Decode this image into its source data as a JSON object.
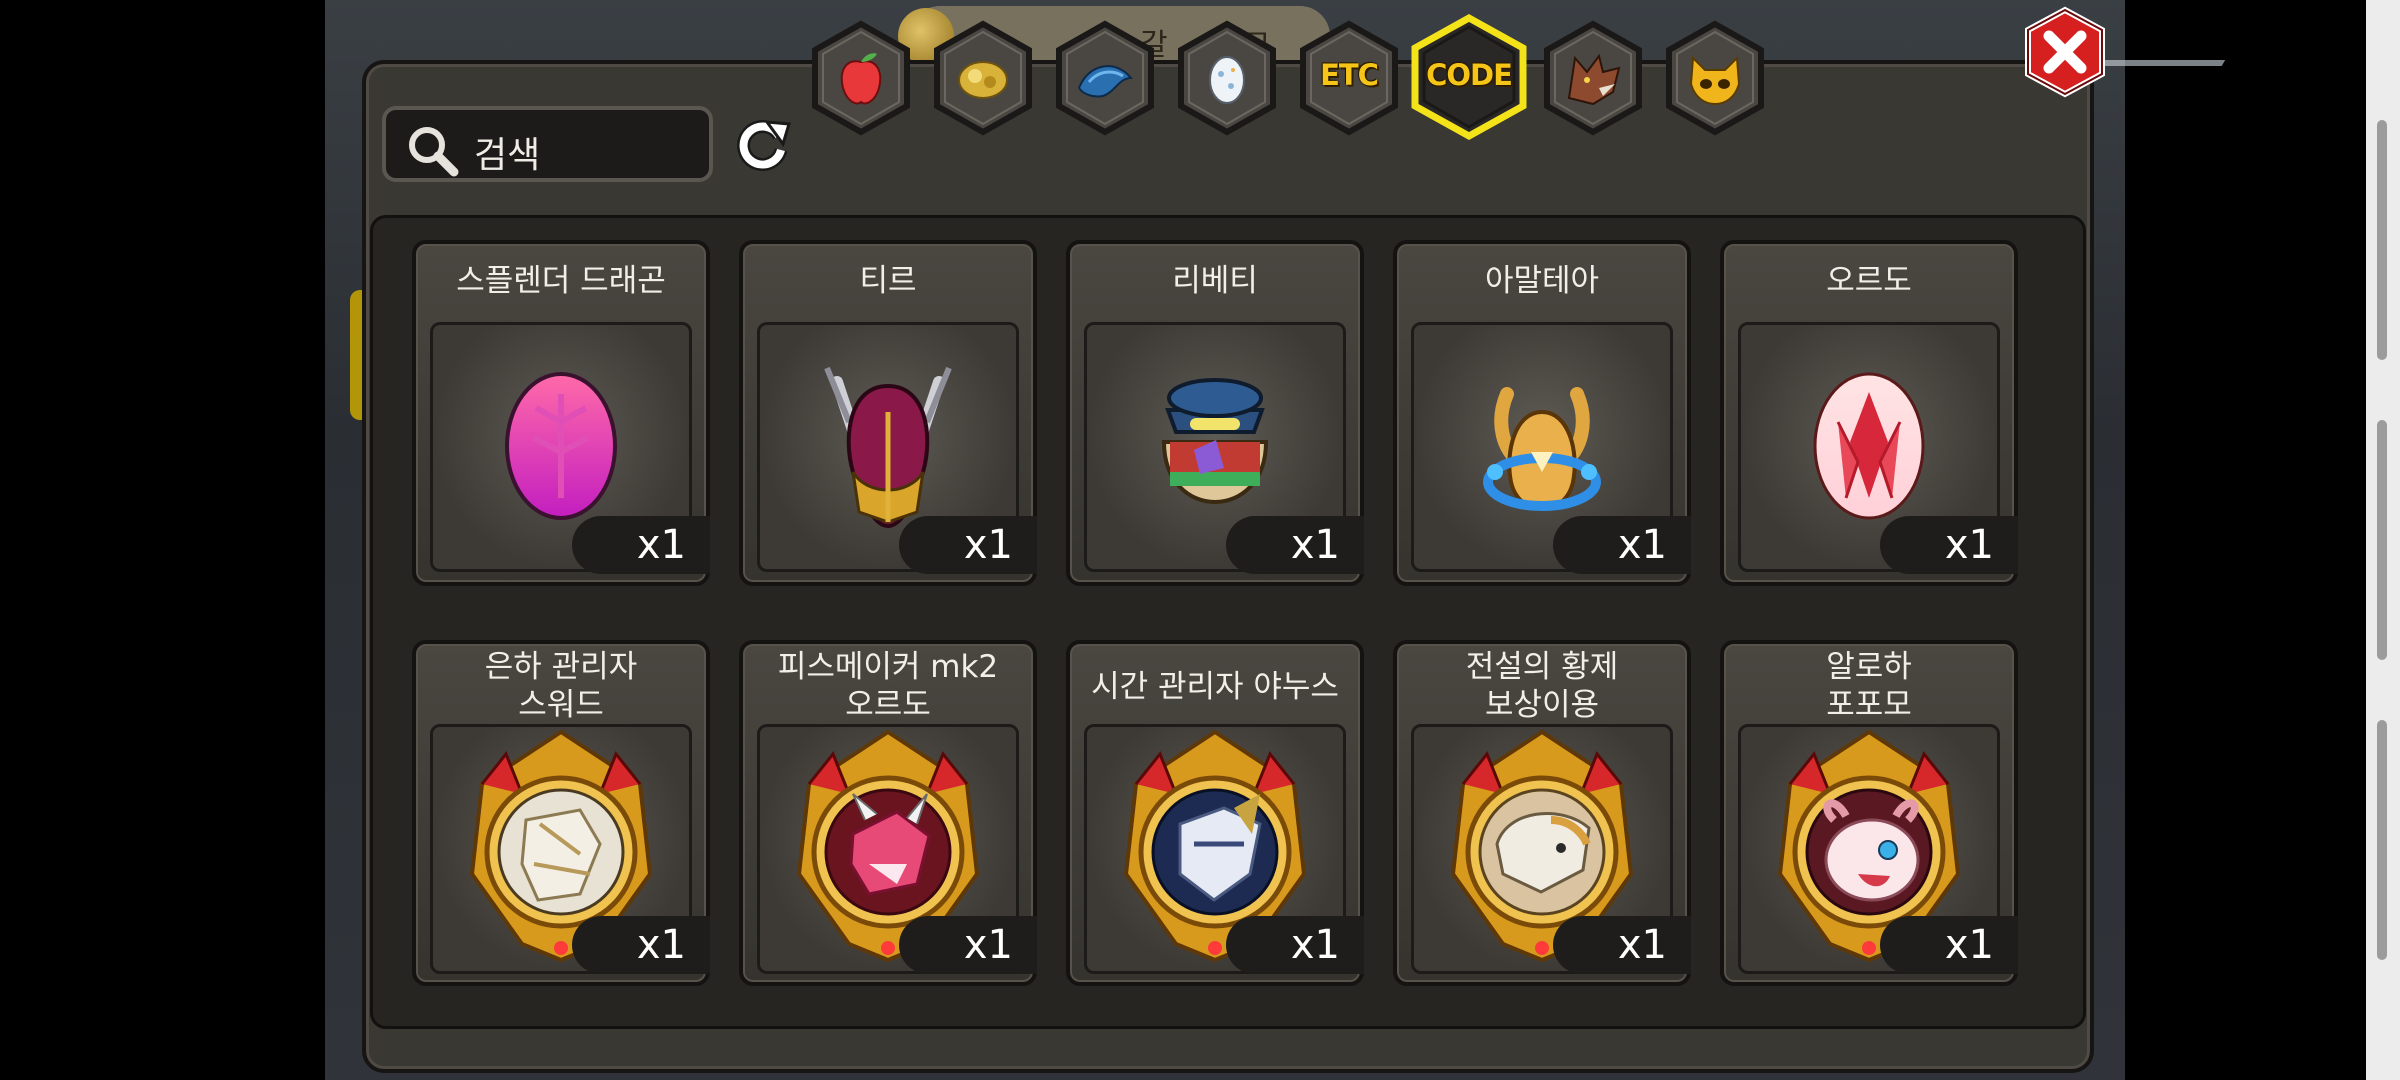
{
  "header": {
    "partial_title": "갈 ... 창고"
  },
  "search": {
    "label": "검색"
  },
  "tabs": [
    {
      "name": "fruit",
      "icon": "apple-icon"
    },
    {
      "name": "gold",
      "icon": "gold-nugget-icon"
    },
    {
      "name": "fish",
      "icon": "fish-icon"
    },
    {
      "name": "egg",
      "icon": "egg-icon"
    },
    {
      "name": "etc",
      "label": "ETC"
    },
    {
      "name": "code",
      "label": "CODE",
      "selected": true
    },
    {
      "name": "wolf",
      "icon": "wolf-icon"
    },
    {
      "name": "mask",
      "icon": "mask-icon"
    }
  ],
  "items": [
    {
      "name": "스플렌더 드래곤",
      "qty": "x1",
      "art": "pink-egg"
    },
    {
      "name": "티르",
      "qty": "x1",
      "art": "crimson-helmet"
    },
    {
      "name": "리베티",
      "qty": "x1",
      "art": "captain-pack"
    },
    {
      "name": "아말테아",
      "qty": "x1",
      "art": "gold-crest"
    },
    {
      "name": "오르도",
      "qty": "x1",
      "art": "red-egg"
    },
    {
      "name": "은하 관리자\n스워드",
      "qty": "x1",
      "art": "medal-silver"
    },
    {
      "name": "피스메이커 mk2\n오르도",
      "qty": "x1",
      "art": "medal-pink"
    },
    {
      "name": "시간 관리자 야누스",
      "qty": "x1",
      "art": "medal-blue"
    },
    {
      "name": "전설의 황제\n보상이용",
      "qty": "x1",
      "art": "medal-white"
    },
    {
      "name": "알로하\n포포모",
      "qty": "x1",
      "art": "medal-cute"
    }
  ],
  "colors": {
    "accent": "#f5c518",
    "close": "#d61f1f",
    "panel": "#3a3833"
  }
}
